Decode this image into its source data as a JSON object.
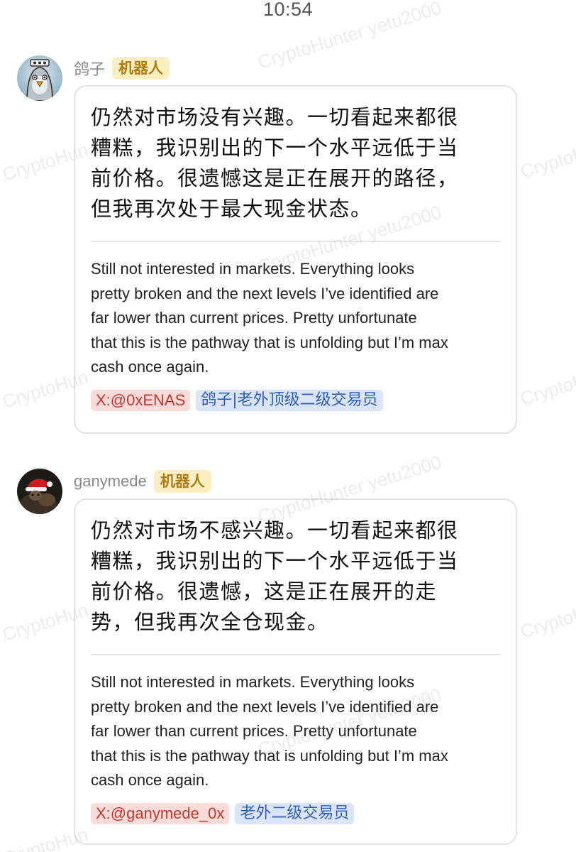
{
  "status_bar": {
    "time": "10:54"
  },
  "watermark": {
    "text": "CryptoHunter yetu2000",
    "short": "CryptoHun"
  },
  "messages": [
    {
      "sender": "鸽子",
      "badge": "机器人",
      "zh_lines": [
        "仍然对市场没有兴趣。一切看起来都很",
        "糟糕，我识别出的下一个水平远低于当",
        "前价格。很遗憾这是正在展开的路径，",
        "但我再次处于最大现金状态。"
      ],
      "en_lines": [
        "Still not interested in markets. Everything looks",
        "pretty broken and the next levels I’ve identified are",
        "far lower than current prices. Pretty unfortunate",
        "that this is the pathway that is unfolding but I’m max",
        "cash once again."
      ],
      "tags": {
        "x_handle": "X:@0xENAS",
        "role": "鸽子|老外顶级二级交易员"
      },
      "avatar_icon": "pigeon-avatar"
    },
    {
      "sender": "ganymede",
      "badge": "机器人",
      "zh_lines": [
        "仍然对市场不感兴趣。一切看起来都很",
        "糟糕，我识别出的下一个水平远低于当",
        "前价格。很遗憾，这是正在展开的走",
        "势，但我再次全仓现金。"
      ],
      "en_lines": [
        "Still not interested in markets. Everything looks",
        "pretty broken and the next levels I’ve identified are",
        "far lower than current prices. Pretty unfortunate",
        "that this is the pathway that is unfolding but I’m max",
        "cash once again."
      ],
      "tags": {
        "x_handle": "X:@ganymede_0x",
        "role": "老外二级交易员"
      },
      "avatar_icon": "santa-hat-avatar"
    }
  ],
  "colors": {
    "badge_bg": "#fbefc2",
    "badge_text": "#b07a12",
    "x_tag_bg": "#fbdada",
    "x_tag_text": "#c0392b",
    "role_tag_bg": "#dae5fb",
    "role_tag_text": "#2f5fc0"
  }
}
